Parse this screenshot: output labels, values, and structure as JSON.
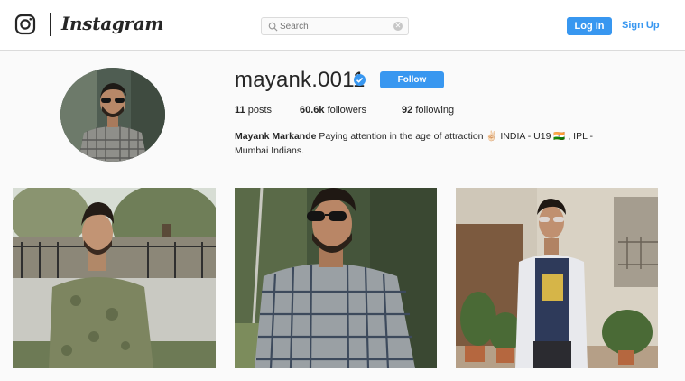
{
  "header": {
    "brand": "Instagram",
    "search_placeholder": "Search",
    "login_label": "Log In",
    "signup_label": "Sign Up",
    "logo_icon": "instagram-camera-icon",
    "search_icon": "search-icon",
    "clear_icon": "clear-search-icon"
  },
  "profile": {
    "username": "mayank.0011",
    "verified": true,
    "follow_label": "Follow",
    "stats": {
      "posts_count": "11",
      "posts_label": "posts",
      "followers_count": "60.6k",
      "followers_label": "followers",
      "following_count": "92",
      "following_label": "following"
    },
    "bio_name": "Mayank Markande",
    "bio_line1": " Paying attention in the age of attraction ✌🏻 INDIA - U19 🇮🇳 , IPL -",
    "bio_line2": "Mumbai Indians."
  },
  "colors": {
    "accent": "#3897f0",
    "text": "#262626",
    "background": "#fafafa",
    "border": "#dbdbdb"
  }
}
